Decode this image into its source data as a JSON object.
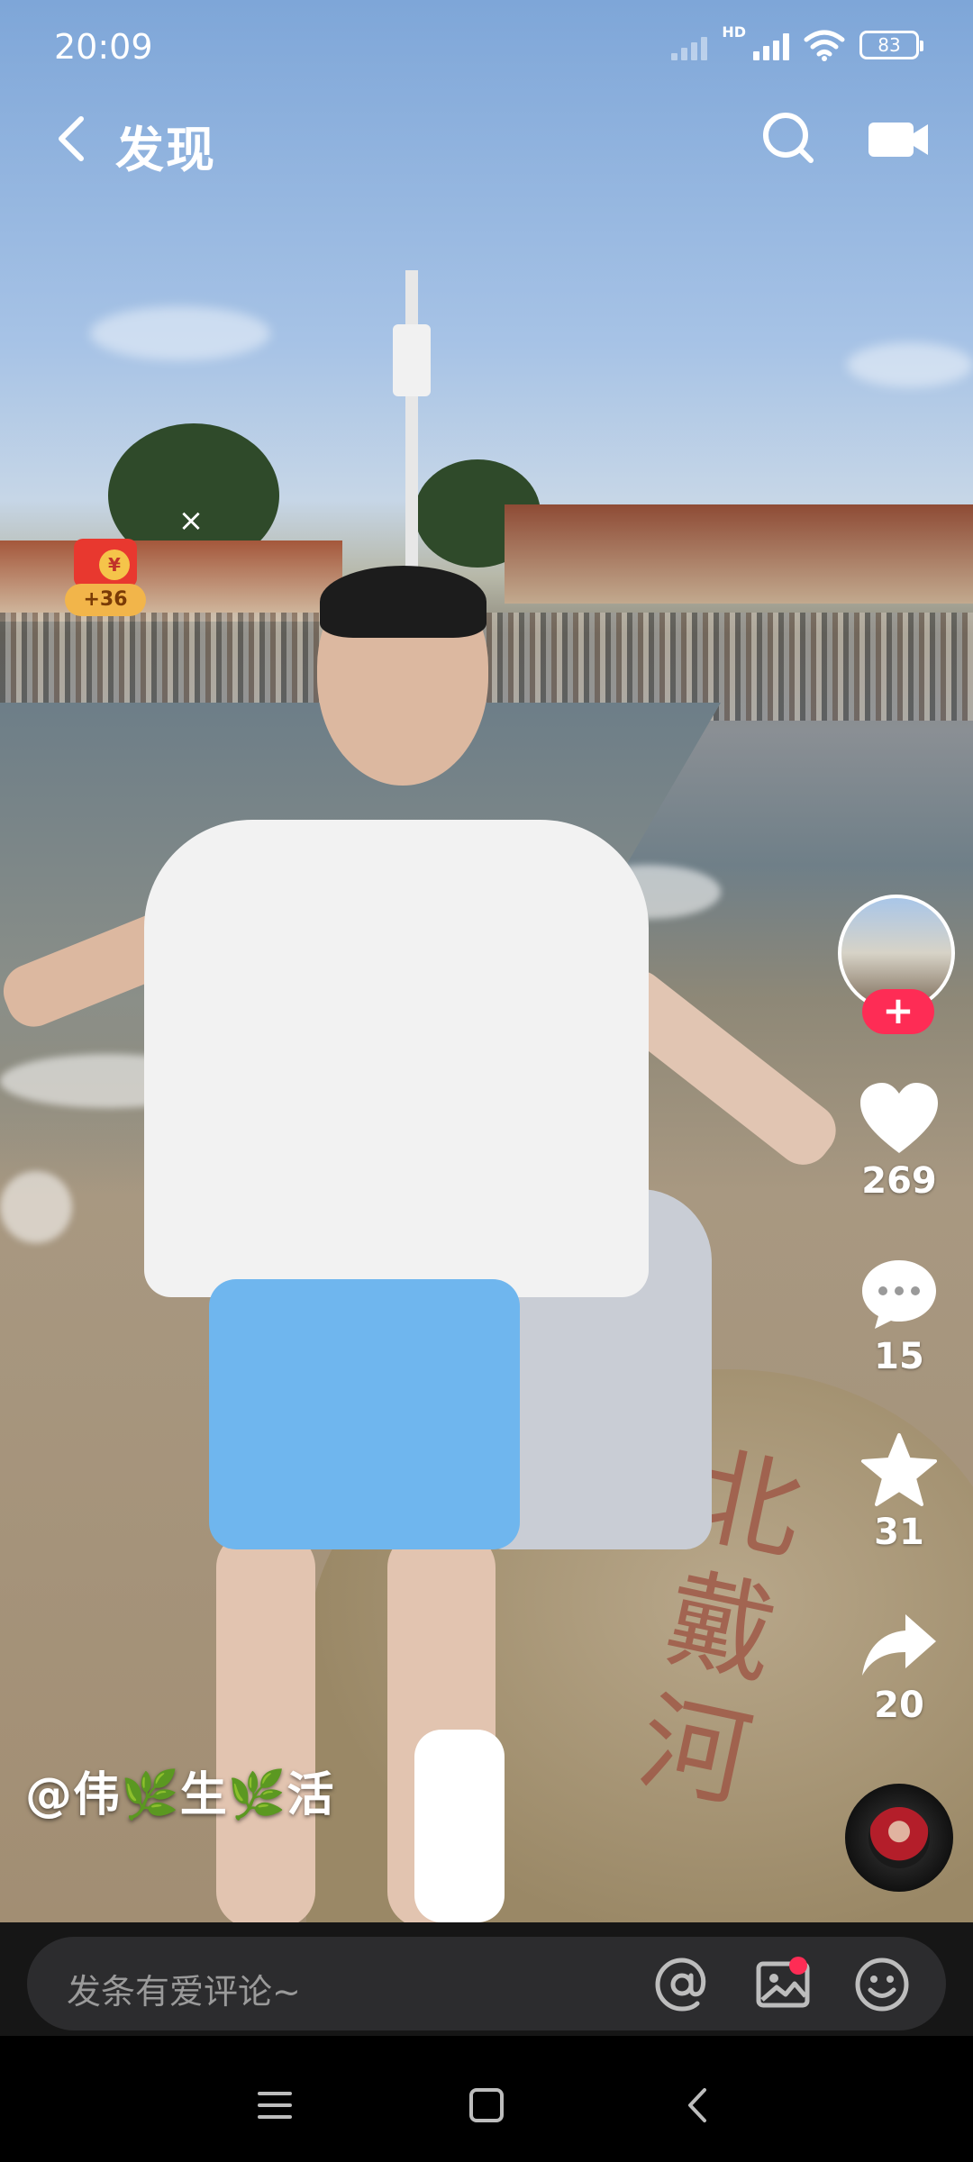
{
  "status_bar": {
    "time": "20:09",
    "hd_label": "HD",
    "battery": "83"
  },
  "nav": {
    "title": "发现",
    "icons": [
      "back-arrow-icon",
      "search-icon",
      "camera-icon"
    ]
  },
  "red_packet": {
    "badge": "+36",
    "coin_symbol": "¥",
    "close_label": "×"
  },
  "video": {
    "rock_inscription": "北戴河"
  },
  "author": {
    "part1": "@伟",
    "leaf": "🌿",
    "part2": "生",
    "part3": "活"
  },
  "actions": {
    "follow_label": "+",
    "likes": "269",
    "comments": "15",
    "favorites": "31",
    "shares": "20"
  },
  "comment_bar": {
    "placeholder": "发条有爱评论~",
    "icons": [
      "at-icon",
      "image-icon",
      "emoji-icon"
    ]
  },
  "colors": {
    "accent": "#fe2c55",
    "comment_bg": "#2c2c2e",
    "red_packet": "#e8382f",
    "red_packet_badge": "#f2b54a"
  }
}
